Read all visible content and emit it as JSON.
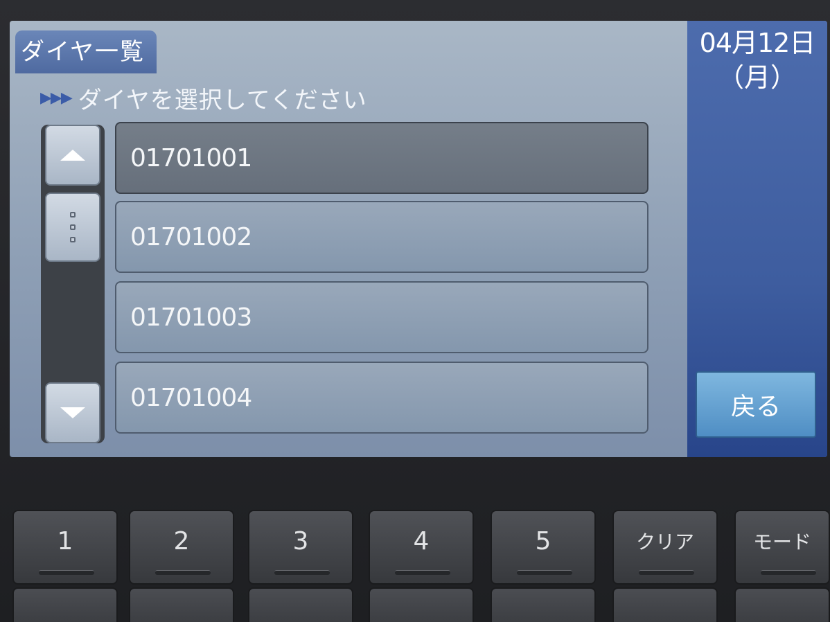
{
  "screen": {
    "title": "ダイヤ一覧",
    "instruction_arrows": "▶▶▶",
    "instruction": "ダイヤを選択してください",
    "date": "04月12日",
    "weekday": "（月）",
    "back_button": "戻る"
  },
  "list": {
    "items": [
      {
        "label": "01701001",
        "selected": true
      },
      {
        "label": "01701002",
        "selected": false
      },
      {
        "label": "01701003",
        "selected": false
      },
      {
        "label": "01701004",
        "selected": false
      }
    ]
  },
  "scroll": {
    "up_icon": "triangle-up-icon",
    "thumb_icon": "grip-icon",
    "down_icon": "triangle-down-icon"
  },
  "keypad": {
    "keys": [
      "1",
      "2",
      "3",
      "4",
      "5",
      "クリア",
      "モード"
    ]
  },
  "colors": {
    "screen_bg": "#a9b7c6",
    "selected_row": "#757e89",
    "right_panel": "#4d6cad",
    "back_button": "#7fb7df"
  }
}
